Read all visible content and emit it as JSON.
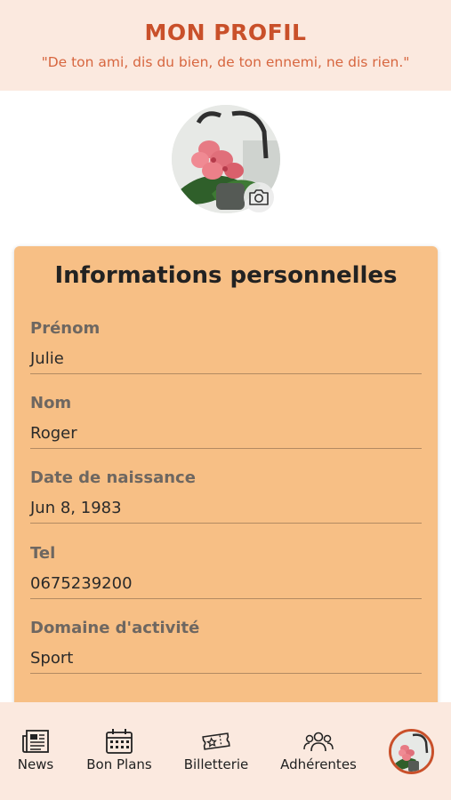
{
  "header": {
    "title": "MON PROFIL",
    "quote": "\"De ton ami, dis du bien, de ton ennemi, ne dis rien.\""
  },
  "avatar": {
    "icon": "orchid-photo",
    "camera_icon": "camera-icon"
  },
  "card": {
    "title": "Informations personnelles",
    "fields": [
      {
        "label": "Prénom",
        "value": "Julie"
      },
      {
        "label": "Nom",
        "value": "Roger"
      },
      {
        "label": "Date de naissance",
        "value": "Jun 8, 1983"
      },
      {
        "label": "Tel",
        "value": "0675239200"
      },
      {
        "label": "Domaine d'activité",
        "value": "Sport"
      }
    ]
  },
  "tabbar": {
    "items": [
      {
        "label": "News",
        "icon": "newspaper-icon"
      },
      {
        "label": "Bon Plans",
        "icon": "calendar-icon"
      },
      {
        "label": "Billetterie",
        "icon": "ticket-icon"
      },
      {
        "label": "Adhérentes",
        "icon": "group-icon"
      }
    ],
    "profile_icon": "profile-avatar-icon"
  },
  "colors": {
    "accent": "#c9502a",
    "header_bg": "#fbe9df",
    "card_bg": "#f7bf85"
  }
}
